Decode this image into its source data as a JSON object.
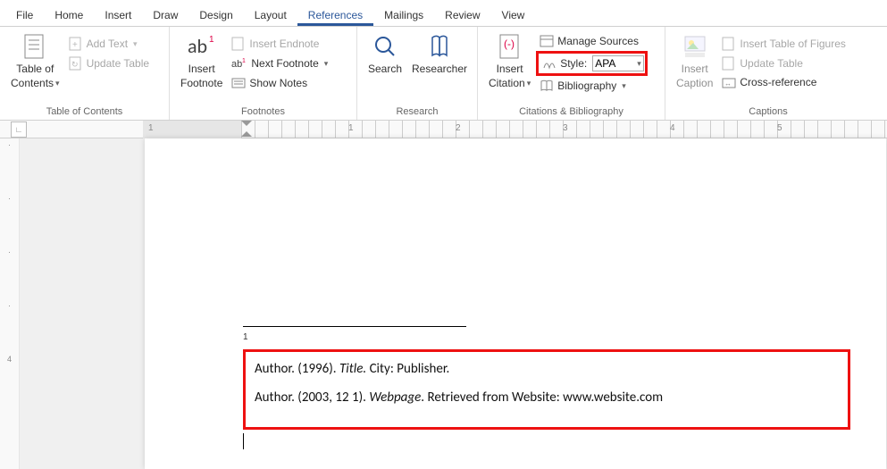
{
  "tabs": [
    "File",
    "Home",
    "Insert",
    "Draw",
    "Design",
    "Layout",
    "References",
    "Mailings",
    "Review",
    "View"
  ],
  "activeTab": "References",
  "groups": {
    "toc": {
      "label": "Table of Contents",
      "tocBtn": "Table of\nContents",
      "addText": "Add Text",
      "update": "Update Table"
    },
    "footnotes": {
      "label": "Footnotes",
      "insertFn": "Insert\nFootnote",
      "insertEn": "Insert Endnote",
      "nextFn": "Next Footnote",
      "showNotes": "Show Notes"
    },
    "research": {
      "label": "Research",
      "search": "Search",
      "researcher": "Researcher"
    },
    "citations": {
      "label": "Citations & Bibliography",
      "insertCit": "Insert\nCitation",
      "manage": "Manage Sources",
      "styleLbl": "Style:",
      "styleVal": "APA",
      "biblio": "Bibliography"
    },
    "captions": {
      "label": "Captions",
      "insertCap": "Insert\nCaption",
      "insertTof": "Insert Table of Figures",
      "update": "Update Table",
      "crossRef": "Cross-reference"
    }
  },
  "ruler": {
    "marks": [
      "1",
      "2",
      "3",
      "4",
      "5"
    ],
    "leftMark": "1"
  },
  "document": {
    "footnoteNum": "1",
    "bib": [
      {
        "author": "Author.",
        "date": "(1996).",
        "title": "Title.",
        "rest": " City: Publisher."
      },
      {
        "author": "Author.",
        "date": "(2003, 12 1).",
        "title": "Webpage",
        "rest": ". Retrieved from Website: www.website.com"
      }
    ]
  }
}
